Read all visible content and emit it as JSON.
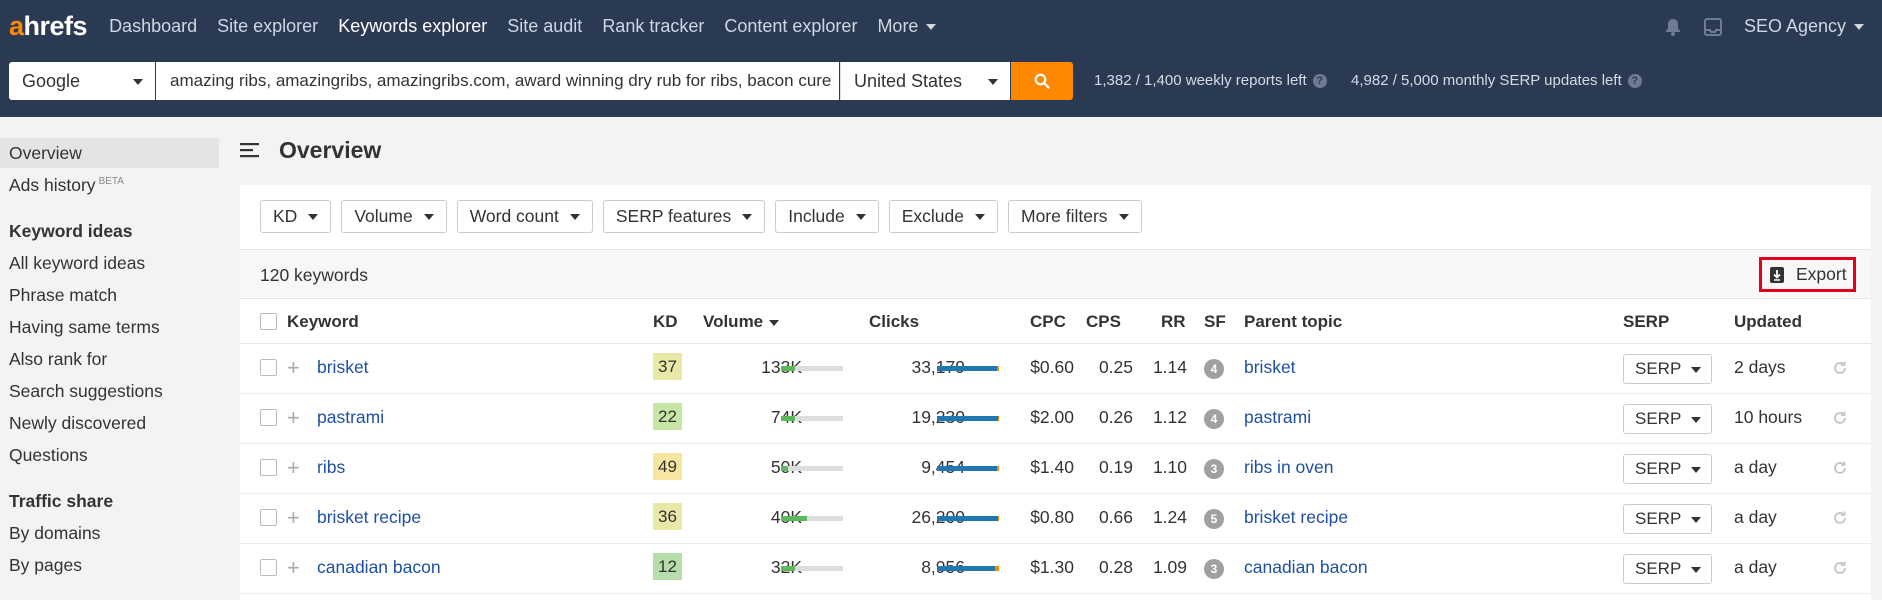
{
  "nav": {
    "logo_a": "a",
    "logo_rest": "hrefs",
    "links": [
      "Dashboard",
      "Site explorer",
      "Keywords explorer",
      "Site audit",
      "Rank tracker",
      "Content explorer",
      "More"
    ],
    "active": "Keywords explorer",
    "account": "SEO Agency"
  },
  "search": {
    "engine": "Google",
    "keywords": "amazing ribs, amazingribs, amazingribs.com, award winning dry rub for ribs, bacon cure",
    "country": "United States",
    "weekly_quota": "1,382 / 1,400 weekly reports left",
    "monthly_quota": "4,982 / 5,000 monthly SERP updates left",
    "help_glyph": "?"
  },
  "sidebar": {
    "overview": "Overview",
    "ads_history": "Ads history",
    "beta": "BETA",
    "keyword_ideas_heading": "Keyword ideas",
    "keyword_ideas": [
      "All keyword ideas",
      "Phrase match",
      "Having same terms",
      "Also rank for",
      "Search suggestions",
      "Newly discovered",
      "Questions"
    ],
    "traffic_share_heading": "Traffic share",
    "traffic_share": [
      "By domains",
      "By pages"
    ]
  },
  "main": {
    "title": "Overview",
    "filters": [
      "KD",
      "Volume",
      "Word count",
      "SERP features",
      "Include",
      "Exclude",
      "More filters"
    ],
    "keyword_count": "120 keywords",
    "export_label": "Export"
  },
  "table": {
    "headers": {
      "keyword": "Keyword",
      "kd": "KD",
      "volume": "Volume",
      "clicks": "Clicks",
      "cpc": "CPC",
      "cps": "CPS",
      "rr": "RR",
      "sf": "SF",
      "parent": "Parent topic",
      "serp": "SERP",
      "updated": "Updated"
    },
    "rows": [
      {
        "keyword": "brisket",
        "kd": "37",
        "kd_color": "#e9e8a6",
        "volume": "133K",
        "volume_fill": 0.22,
        "clicks": "33,179",
        "clicks_fill": 0.97,
        "cpc": "$0.60",
        "cps": "0.25",
        "rr": "1.14",
        "sf": "4",
        "parent": "brisket",
        "serp": "SERP",
        "updated": "2 days"
      },
      {
        "keyword": "pastrami",
        "kd": "22",
        "kd_color": "#c7e5a4",
        "volume": "74K",
        "volume_fill": 0.22,
        "clicks": "19,230",
        "clicks_fill": 0.98,
        "cpc": "$2.00",
        "cps": "0.26",
        "rr": "1.12",
        "sf": "4",
        "parent": "pastrami",
        "serp": "SERP",
        "updated": "10 hours"
      },
      {
        "keyword": "ribs",
        "kd": "49",
        "kd_color": "#f6e6a0",
        "volume": "50K",
        "volume_fill": 0.12,
        "clicks": "9,454",
        "clicks_fill": 0.97,
        "cpc": "$1.40",
        "cps": "0.19",
        "rr": "1.10",
        "sf": "3",
        "parent": "ribs in oven",
        "serp": "SERP",
        "updated": "a day"
      },
      {
        "keyword": "brisket recipe",
        "kd": "36",
        "kd_color": "#e9e8a6",
        "volume": "40K",
        "volume_fill": 0.42,
        "clicks": "26,200",
        "clicks_fill": 0.98,
        "cpc": "$0.80",
        "cps": "0.66",
        "rr": "1.24",
        "sf": "5",
        "parent": "brisket recipe",
        "serp": "SERP",
        "updated": "a day"
      },
      {
        "keyword": "canadian bacon",
        "kd": "12",
        "kd_color": "#b5deaa",
        "volume": "32K",
        "volume_fill": 0.22,
        "clicks": "8,956",
        "clicks_fill": 0.94,
        "cpc": "$1.30",
        "cps": "0.28",
        "rr": "1.09",
        "sf": "3",
        "parent": "canadian bacon",
        "serp": "SERP",
        "updated": "a day"
      }
    ]
  },
  "colors": {
    "nav_bg": "#2b3a53",
    "accent": "#ff8800",
    "link": "#1e4fa5",
    "volume_bar": "#5cb85c",
    "clicks_bar": "#1f77b4",
    "clicks_bar_paid": "#ff8800",
    "export_highlight": "#e3001b"
  }
}
